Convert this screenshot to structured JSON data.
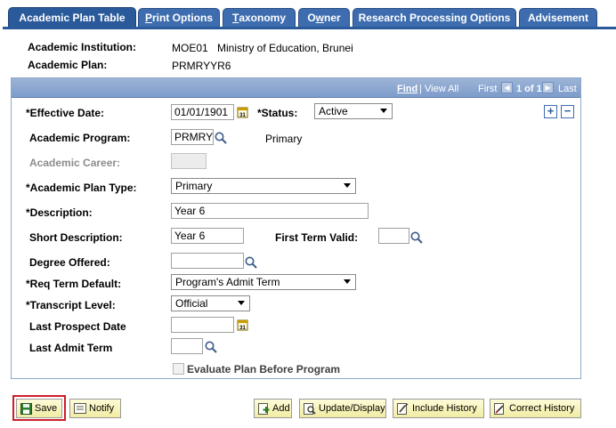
{
  "tabs": [
    {
      "pre": "",
      "u": "",
      "post": "Academic Plan Table"
    },
    {
      "pre": "",
      "u": "P",
      "post": "rint Options"
    },
    {
      "pre": "",
      "u": "T",
      "post": "axonomy"
    },
    {
      "pre": "O",
      "u": "w",
      "post": "ner"
    },
    {
      "pre": "",
      "u": "",
      "post": "Research Processing Options"
    },
    {
      "pre": "",
      "u": "",
      "post": "Advisement"
    }
  ],
  "header": {
    "institution_label": "Academic Institution:",
    "institution_code": "MOE01",
    "institution_name": "Ministry of Education, Brunei",
    "plan_label": "Academic Plan:",
    "plan_value": "PRMRYYR6"
  },
  "nav": {
    "find": "Find",
    "sep": "|",
    "view_all": "View All",
    "first": "First",
    "range": "1 of 1",
    "last": "Last"
  },
  "form": {
    "effective_date_label": "*Effective Date:",
    "effective_date_value": "01/01/1901",
    "status_label": "*Status:",
    "status_value": "Active",
    "program_label": "Academic Program:",
    "program_value": "PRMRY",
    "program_desc": "Primary",
    "career_label": "Academic Career:",
    "career_value": "",
    "plan_type_label": "*Academic Plan Type:",
    "plan_type_value": "Primary",
    "description_label": "*Description:",
    "description_value": "Year 6",
    "short_desc_label": "Short Description:",
    "short_desc_value": "Year 6",
    "first_term_label": "First Term Valid:",
    "first_term_value": "",
    "degree_label": "Degree Offered:",
    "degree_value": "",
    "req_term_label": "*Req Term Default:",
    "req_term_value": "Program's Admit Term",
    "transcript_label": "*Transcript Level:",
    "transcript_value": "Official",
    "last_prospect_label": "Last Prospect Date",
    "last_prospect_value": "",
    "last_admit_label": "Last Admit Term",
    "last_admit_value": "",
    "evaluate_label": "Evaluate Plan Before Program",
    "evaluate_checked": false
  },
  "buttons": {
    "save": "Save",
    "notify": "Notify",
    "add": "Add",
    "update_display": "Update/Display",
    "include_history": "Include History",
    "correct_history": "Correct History"
  },
  "colors": {
    "tab_bg": "#3e6daf",
    "tab_active_bg": "#2b5a9b",
    "save_highlight": "#cc1f2a",
    "button_bg": "#f1eca3"
  }
}
